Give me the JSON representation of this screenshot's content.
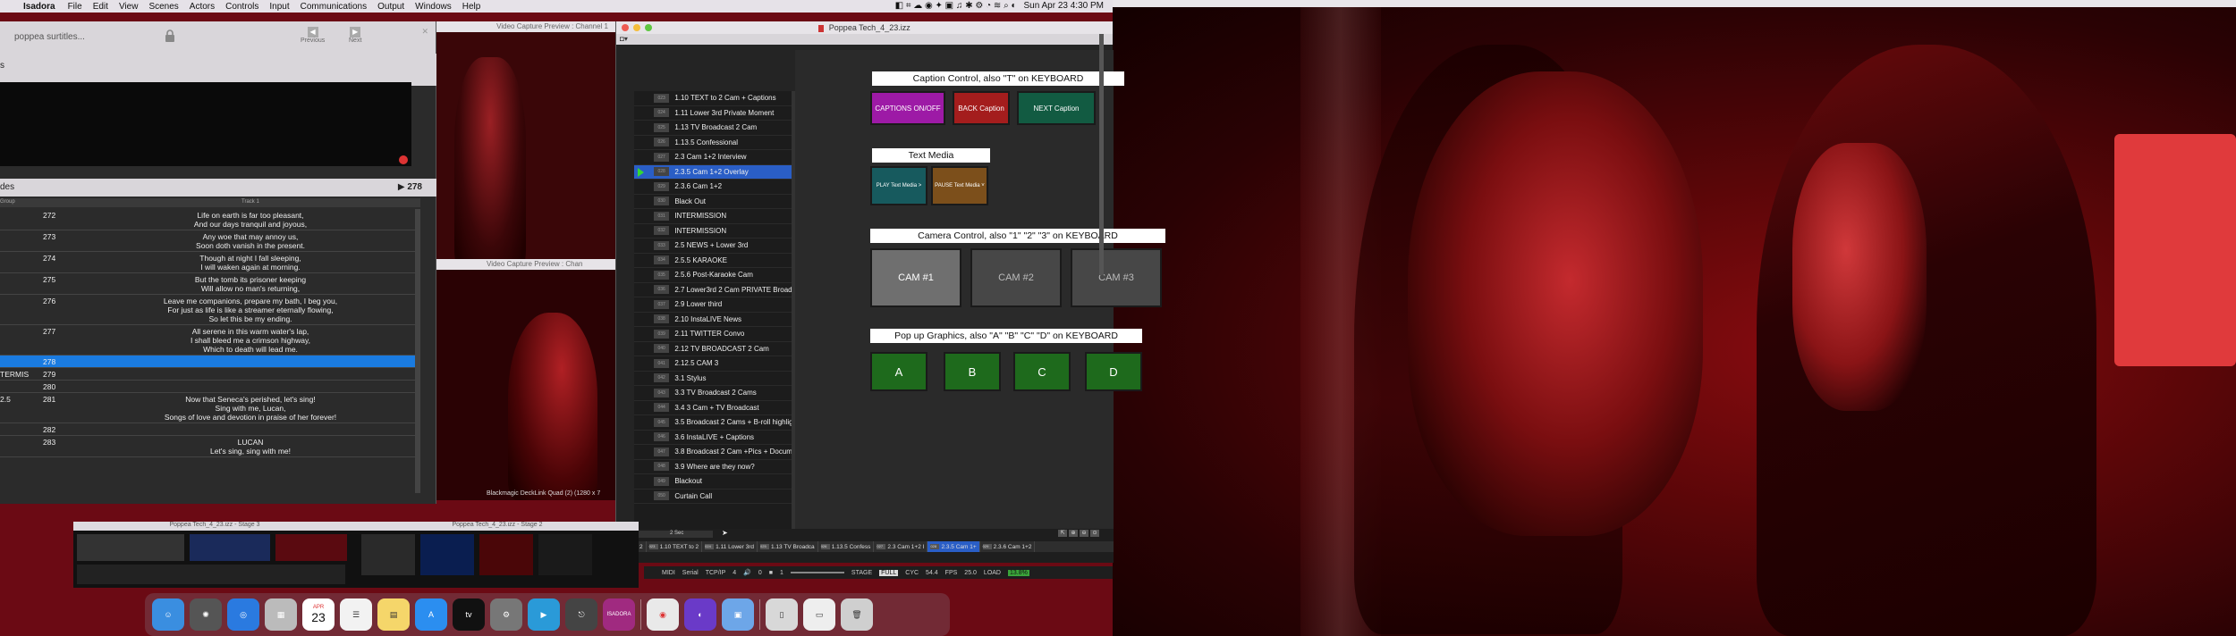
{
  "menubar": {
    "apple": "",
    "app_name": "Isadora",
    "items": [
      "File",
      "Edit",
      "View",
      "Scenes",
      "Actors",
      "Controls",
      "Input",
      "Communications",
      "Output",
      "Windows",
      "Help"
    ],
    "datetime": "Sun Apr 23  4:30 PM"
  },
  "text_panel": {
    "title": "poppea surtitles...",
    "nav_previous": "Previous",
    "nav_next": "Next",
    "section1_label": "s",
    "section2_label": "des",
    "count": "▶ 278",
    "header_cue": "Group",
    "header_track": "Track 1",
    "rows": [
      {
        "c0": "",
        "c1": "272",
        "text": "Life on earth is far too pleasant,\nAnd our days tranquil and joyous,"
      },
      {
        "c0": "",
        "c1": "273",
        "text": "Any woe that may annoy us,\nSoon doth vanish in the present."
      },
      {
        "c0": "",
        "c1": "274",
        "text": "Though at night I fall sleeping,\nI will waken again at morning."
      },
      {
        "c0": "",
        "c1": "275",
        "text": "But the tomb its prisoner keeping\nWill allow no man's returning,"
      },
      {
        "c0": "",
        "c1": "276",
        "text": "Leave me companions, prepare my bath, I beg you,\nFor just as life is like a streamer eternally flowing,\nSo let this be my ending."
      },
      {
        "c0": "",
        "c1": "277",
        "text": "All serene in this warm water's lap,\nI shall bleed me a crimson highway,\nWhich to death will lead me."
      },
      {
        "c0": "",
        "c1": "278",
        "text": "",
        "selected": true
      },
      {
        "c0": "TERMIS",
        "c1": "279",
        "text": ""
      },
      {
        "c0": "",
        "c1": "280",
        "text": ""
      },
      {
        "c0": "2.5",
        "c1": "281",
        "text": "Now that Seneca's perished, let's sing!\nSing with me, Lucan,\nSongs of love and devotion in praise of her forever!"
      },
      {
        "c0": "",
        "c1": "282",
        "text": ""
      },
      {
        "c0": "",
        "c1": "283",
        "text": "LUCAN\nLet's sing, sing with me!"
      }
    ]
  },
  "video_preview_1": {
    "title": "Video Capture Preview : Channel 1"
  },
  "video_preview_2": {
    "title": "Video Capture Preview : Chan",
    "device": "Blackmagic DeckLink Quad (2) (1280 x 7"
  },
  "main_window": {
    "title": "Poppea Tech_4_23.izz",
    "scenes": [
      {
        "id": "023",
        "name": "1.10 TEXT to 2 Cam + Captions"
      },
      {
        "id": "024",
        "name": "1.11 Lower 3rd Private Moment"
      },
      {
        "id": "025",
        "name": "1.13 TV Broadcast 2 Cam"
      },
      {
        "id": "026",
        "name": "1.13.5 Confessional"
      },
      {
        "id": "027",
        "name": "2.3 Cam 1+2 Interview"
      },
      {
        "id": "028",
        "name": "2.3.5 Cam 1+2 Overlay",
        "selected": true
      },
      {
        "id": "029",
        "name": "2.3.6 Cam 1+2"
      },
      {
        "id": "030",
        "name": "Black Out"
      },
      {
        "id": "031",
        "name": "INTERMISSION"
      },
      {
        "id": "032",
        "name": "INTERMISSION"
      },
      {
        "id": "033",
        "name": "2.5 NEWS + Lower 3rd"
      },
      {
        "id": "034",
        "name": "2.5.5 KARAOKE"
      },
      {
        "id": "035",
        "name": "2.5.6 Post-Karaoke Cam"
      },
      {
        "id": "036",
        "name": "2.7 Lower3rd 2 Cam PRIVATE Broadcast"
      },
      {
        "id": "037",
        "name": "2.9 Lower third"
      },
      {
        "id": "038",
        "name": "2.10 InstaLIVE News"
      },
      {
        "id": "039",
        "name": "2.11 TWITTER Convo"
      },
      {
        "id": "040",
        "name": "2.12 TV BROADCAST 2 Cam"
      },
      {
        "id": "041",
        "name": "2.12.5 CAM 3"
      },
      {
        "id": "042",
        "name": "3.1 Stylus"
      },
      {
        "id": "043",
        "name": "3.3 TV Broadcast  2 Cams"
      },
      {
        "id": "044",
        "name": "3.4  3 Cam + TV Broadcast"
      },
      {
        "id": "045",
        "name": "3.5 Broadcast 2 Cams + B-roll highlight"
      },
      {
        "id": "046",
        "name": "3.6 InstaLIVE + Captions"
      },
      {
        "id": "047",
        "name": "3.8 Broadcast 2 Cam +Pics + Documents"
      },
      {
        "id": "048",
        "name": "3.9 Where are they now?"
      },
      {
        "id": "049",
        "name": "Blackout"
      },
      {
        "id": "050",
        "name": "Curtain Call"
      }
    ],
    "caption_control": {
      "header": "Caption Control, also \"T\" on KEYBOARD",
      "on_off": "CAPTIONS ON/OFF",
      "back": "BACK Caption",
      "next": "NEXT Caption"
    },
    "text_media": {
      "header": "Text Media",
      "play": "PLAY Text Media >",
      "pause": "PAUSE Text Media ˅"
    },
    "camera_control": {
      "header": "Camera Control, also \"1\" \"2\" \"3\" on KEYBOARD",
      "cams": [
        "CAM #1",
        "CAM #2",
        "CAM #3"
      ]
    },
    "popup_graphics": {
      "header": "Pop up Graphics, also \"A\" \"B\" \"C\" \"D\" on KEYBOARD",
      "buttons": [
        "A",
        "B",
        "C",
        "D"
      ]
    },
    "bottom_tabs": [
      {
        "id": "",
        "name": "n + 2"
      },
      {
        "id": "023",
        "name": "1.10 TEXT to 2"
      },
      {
        "id": "024",
        "name": "1.11 Lower 3rd"
      },
      {
        "id": "025",
        "name": "1.13 TV Broadca"
      },
      {
        "id": "026",
        "name": "1.13.5 Confess"
      },
      {
        "id": "027",
        "name": "2.3 Cam 1+2 I"
      },
      {
        "id": "028",
        "name": "2.3.5 Cam 1+",
        "selected": true
      },
      {
        "id": "029",
        "name": "2.3.6 Cam 1+2"
      }
    ],
    "zoom_label": "2 Sec"
  },
  "status_bar": {
    "midi": "MIDI",
    "serial": "Serial",
    "tcpip": "TCP/IP",
    "val1": "4",
    "val2": "0",
    "val3": "1",
    "stage": "STAGE",
    "full": "FULL",
    "cyc_label": "CYC",
    "cyc": "54.4",
    "fps_label": "FPS",
    "fps": "25.0",
    "load_label": "LOAD",
    "load": "13.8%"
  },
  "stages": {
    "stage3": "Poppea Tech_4_23.izz - Stage 3",
    "stage2": "Poppea Tech_4_23.izz - Stage 2"
  },
  "dock": {
    "calendar_month": "APR",
    "calendar_day": "23",
    "isadora_label": "ISADORA",
    "apps": [
      "finder-icon",
      "launchpad-icon",
      "safari-icon",
      "apps-grid-icon",
      "calendar-icon",
      "reminders-icon",
      "notes-icon",
      "app-store-icon",
      "apple-tv-icon",
      "system-settings-icon",
      "keynote-icon",
      "screen-capture-icon",
      "isadora-icon",
      "chrome-icon",
      "siri-icon",
      "preview-icon",
      "files-icon",
      "document-icon",
      "trash-icon"
    ]
  },
  "colors": {
    "caption_on": "#9d1aa6",
    "caption_back": "#a41d1d",
    "caption_next": "#125b42",
    "text_play": "#175a5e",
    "text_pause": "#7c4f1b",
    "cam_active": "#6f6f6f",
    "cam_inactive": "#474747",
    "popup": "#1e6a1c",
    "selection": "#2a5ec6"
  }
}
